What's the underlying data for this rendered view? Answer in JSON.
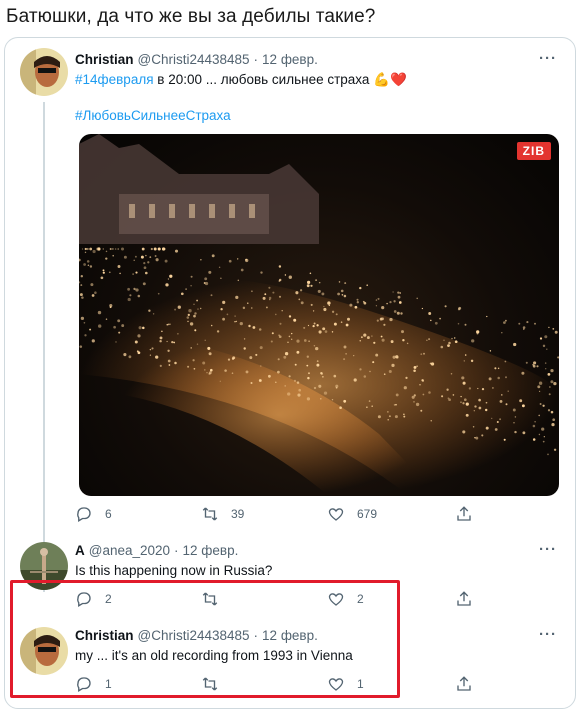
{
  "caption": "Батюшки, да что же вы за дебилы такие?",
  "tweets": [
    {
      "name": "Christian",
      "handle": "@Christi24438485",
      "dot": "·",
      "date": "12 февр.",
      "text_hashtag": "#14февраля",
      "text_rest": " в 20:00 ... любовь сильнее страха 💪❤️",
      "text_line2": "#ЛюбовьСильнееСтраха",
      "media_badge": "ZIB",
      "replies": "6",
      "retweets": "39",
      "likes": "679"
    },
    {
      "name": "A",
      "handle": "@anea_2020",
      "dot": "·",
      "date": "12 февр.",
      "text": "Is this happening now in Russia?",
      "replies": "2",
      "retweets": "",
      "likes": "2"
    },
    {
      "name": "Christian",
      "handle": "@Christi24438485",
      "dot": "·",
      "date": "12 февр.",
      "text": "my ... it's an old recording from 1993 in Vienna",
      "replies": "1",
      "retweets": "",
      "likes": "1"
    }
  ],
  "more_label": "···",
  "colors": {
    "accent": "#1d9bf0",
    "highlight": "#e11b2b",
    "muted": "#536471"
  }
}
